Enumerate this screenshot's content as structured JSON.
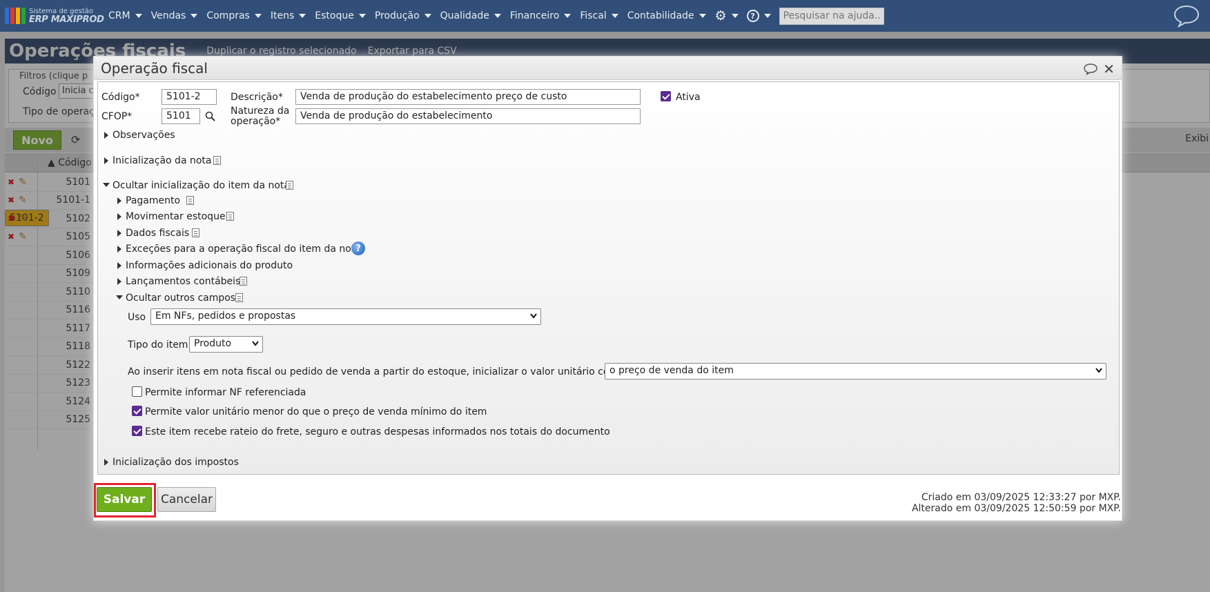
{
  "topnav": {
    "logo_line1": "Sistema de gestão",
    "logo_line2": "ERP MAXIPROD",
    "menu": [
      "CRM",
      "Vendas",
      "Compras",
      "Itens",
      "Estoque",
      "Produção",
      "Qualidade",
      "Financeiro",
      "Fiscal",
      "Contabilidade"
    ],
    "search_placeholder": "Pesquisar na ajuda..."
  },
  "page": {
    "title": "Operações fiscais",
    "toolbar_duplicate": "Duplicar o registro selecionado",
    "toolbar_export": "Exportar para CSV",
    "filters_legend": "Filtros (clique p",
    "filter_code_label": "Código",
    "filter_code_value": "Inicia c",
    "filter_type_label": "Tipo de operaç",
    "new_button": "Novo",
    "exibir": "Exibi",
    "col_codigo": "Código",
    "rows": [
      "5101",
      "5101-1",
      "5101-2",
      "5102",
      "5105",
      "5106",
      "5109",
      "5110",
      "5116",
      "5117",
      "5118",
      "5122",
      "5123",
      "5124",
      "5125"
    ]
  },
  "modal": {
    "title": "Operação fiscal",
    "codigo_label": "Código*",
    "codigo_value": "5101-2",
    "descricao_label": "Descrição*",
    "descricao_value": "Venda de produção do estabelecimento preço de custo",
    "ativa_label": "Ativa",
    "cfop_label": "CFOP*",
    "cfop_value": "5101",
    "natureza_label1": "Natureza da",
    "natureza_label2": "operação*",
    "natureza_value": "Venda de produção do estabelecimento",
    "sec_observacoes": "Observações",
    "sec_init_nota": "Inicialização da nota",
    "sec_ocultar_init_item": "Ocultar inicialização do item da nota",
    "sub_pagamento": "Pagamento",
    "sub_movimentar": "Movimentar estoque",
    "sub_dados_fiscais": "Dados fiscais",
    "sub_excecoes": "Exceções para a operação fiscal do item da nota",
    "sub_info_adic": "Informações adicionais do produto",
    "sub_lancamentos": "Lançamentos contábeis",
    "sub_ocultar_outros": "Ocultar outros campos",
    "uso_label": "Uso",
    "uso_value": "Em NFs, pedidos e propostas",
    "tipo_item_label": "Tipo do item",
    "tipo_item_value": "Produto",
    "inserir_label": "Ao inserir itens em nota fiscal ou pedido de venda a partir do estoque, inicializar o valor unitário com:",
    "inserir_value": "o preço de venda do item",
    "chk1_label": "Permite informar NF referenciada",
    "chk2_label": "Permite valor unitário menor do que o preço de venda mínimo do item",
    "chk3_label": "Este item recebe rateio do frete, seguro e outras despesas informados nos totais do documento",
    "sec_init_impostos": "Inicialização dos impostos",
    "salvar": "Salvar",
    "cancelar": "Cancelar",
    "criado": "Criado em 03/09/2025 12:33:27 por MXP.",
    "alterado": "Alterado em 03/09/2025 12:50:59 por MXP."
  },
  "colors": {
    "nav_bg": "#314f78",
    "accent_green": "#6fae1c",
    "checkbox_purple": "#5b2c91",
    "highlight_red": "#e0232d",
    "selected_row": "#e8a800"
  }
}
